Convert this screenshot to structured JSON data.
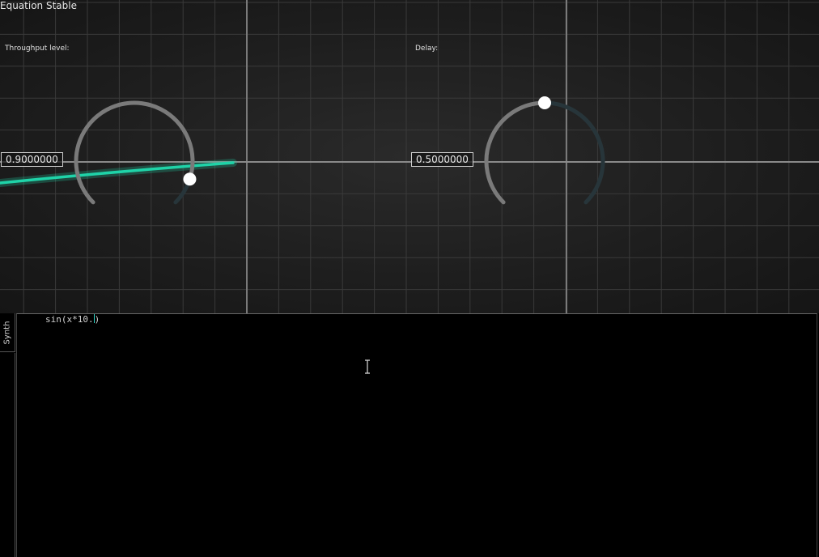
{
  "status": {
    "title": "Equation Stable"
  },
  "colors": {
    "accent": "#1fd3a8",
    "knob_track": "#7a7a7a",
    "knob_remaining": "#27353a",
    "knob_handle": "#ffffff",
    "grid_bg": "#1e1e1e"
  },
  "controls": {
    "throughput": {
      "label": "Throughput level:",
      "value_text": "0.9000000",
      "value": 0.9
    },
    "delay": {
      "label": "Delay:",
      "value_text": "0.5000000",
      "value": 0.5
    }
  },
  "sidebar": {
    "tabs": [
      "Synth"
    ]
  },
  "editor": {
    "code_before_caret": "sin(x*10.",
    "code_after_caret": ")"
  },
  "icons": {
    "text_cursor": "i-beam-cursor-icon"
  }
}
